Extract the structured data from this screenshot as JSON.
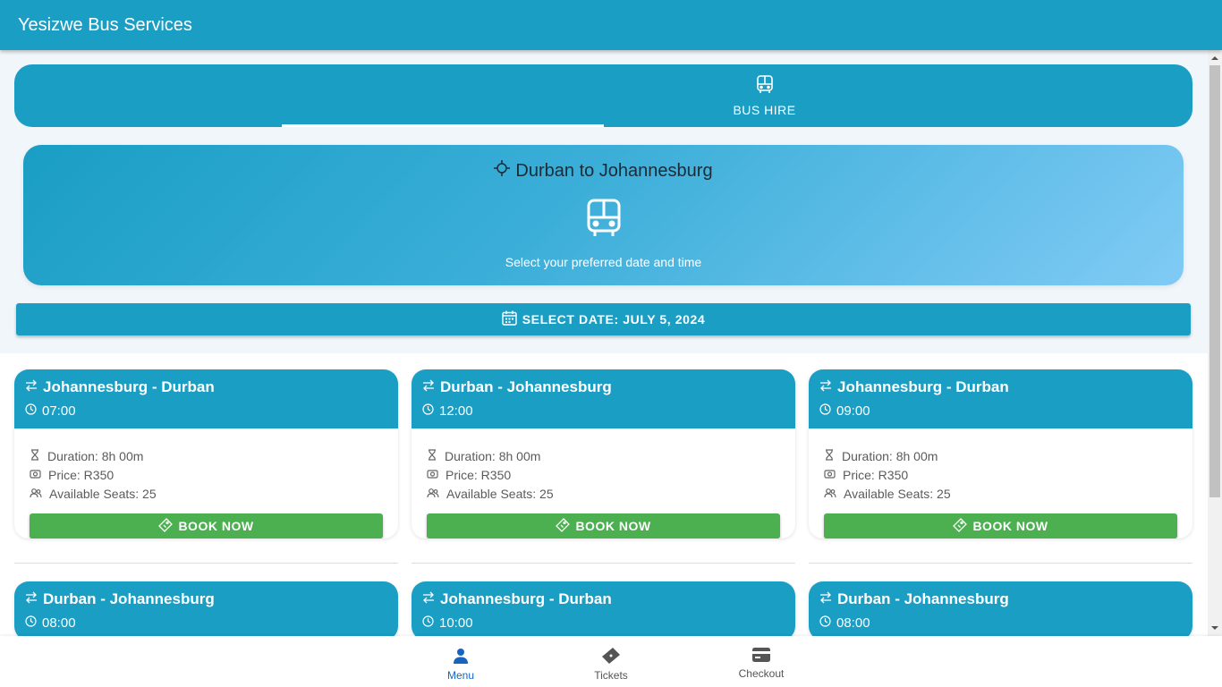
{
  "app": {
    "title": "Yesizwe Bus Services"
  },
  "tabs": [
    {
      "label": "",
      "icon": "blank-tab",
      "active": true
    },
    {
      "label": "BUS HIRE",
      "icon": "bus-icon",
      "active": false
    }
  ],
  "hero": {
    "title": "Durban to Johannesburg",
    "subtitle": "Select your preferred date and time",
    "icon": "bus-icon"
  },
  "date_button": {
    "label": "SELECT DATE: JULY 5, 2024",
    "icon": "calendar-icon"
  },
  "trips": [
    {
      "route": "Johannesburg - Durban",
      "time": "07:00",
      "duration": "Duration: 8h 00m",
      "price": "Price: R350",
      "seats": "Available Seats: 25",
      "book_label": "BOOK NOW"
    },
    {
      "route": "Durban - Johannesburg",
      "time": "12:00",
      "duration": "Duration: 8h 00m",
      "price": "Price: R350",
      "seats": "Available Seats: 25",
      "book_label": "BOOK NOW"
    },
    {
      "route": "Johannesburg - Durban",
      "time": "09:00",
      "duration": "Duration: 8h 00m",
      "price": "Price: R350",
      "seats": "Available Seats: 25",
      "book_label": "BOOK NOW"
    },
    {
      "route": "Durban - Johannesburg",
      "time": "08:00"
    },
    {
      "route": "Johannesburg - Durban",
      "time": "10:00"
    },
    {
      "route": "Durban - Johannesburg",
      "time": "08:00"
    }
  ],
  "bottom_nav": [
    {
      "label": "Menu",
      "icon": "person-icon",
      "active": true
    },
    {
      "label": "Tickets",
      "icon": "ticket-icon",
      "active": false
    },
    {
      "label": "Checkout",
      "icon": "card-icon",
      "active": false
    }
  ],
  "colors": {
    "primary": "#1a9ec4",
    "success": "#4caf50",
    "active_nav": "#1565c0"
  }
}
